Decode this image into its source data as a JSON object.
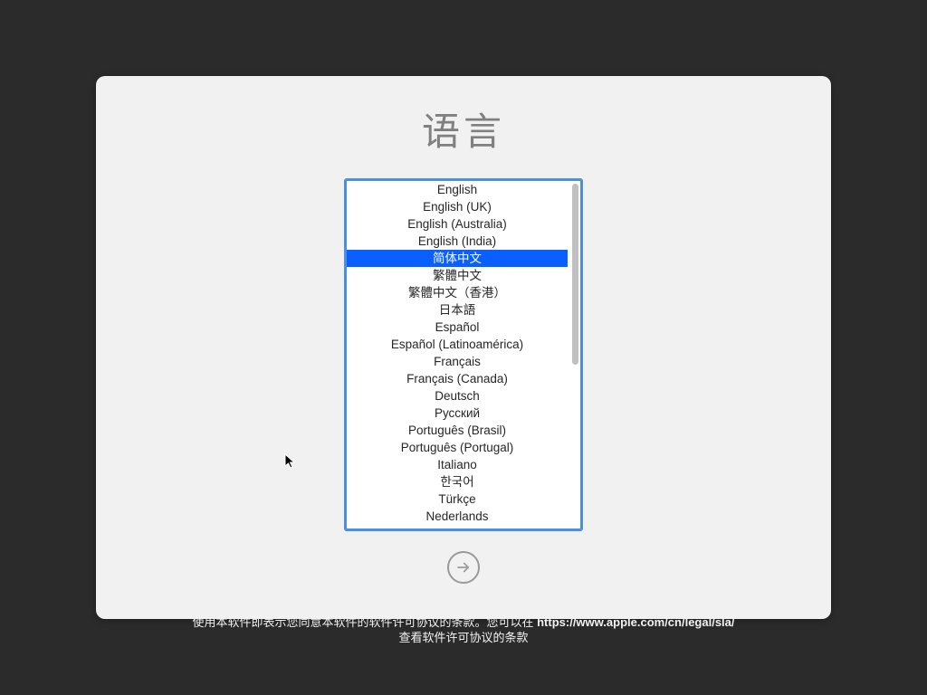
{
  "title": "语言",
  "languages": [
    {
      "label": "English",
      "selected": false
    },
    {
      "label": "English (UK)",
      "selected": false
    },
    {
      "label": "English (Australia)",
      "selected": false
    },
    {
      "label": "English (India)",
      "selected": false
    },
    {
      "label": "简体中文",
      "selected": true
    },
    {
      "label": "繁體中文",
      "selected": false
    },
    {
      "label": "繁體中文（香港）",
      "selected": false
    },
    {
      "label": "日本語",
      "selected": false
    },
    {
      "label": "Español",
      "selected": false
    },
    {
      "label": "Español (Latinoamérica)",
      "selected": false
    },
    {
      "label": "Français",
      "selected": false
    },
    {
      "label": "Français (Canada)",
      "selected": false
    },
    {
      "label": "Deutsch",
      "selected": false
    },
    {
      "label": "Русский",
      "selected": false
    },
    {
      "label": "Português (Brasil)",
      "selected": false
    },
    {
      "label": "Português (Portugal)",
      "selected": false
    },
    {
      "label": "Italiano",
      "selected": false
    },
    {
      "label": "한국어",
      "selected": false
    },
    {
      "label": "Türkçe",
      "selected": false
    },
    {
      "label": "Nederlands",
      "selected": false
    }
  ],
  "footer": {
    "line1_prefix": "使用本软件即表示您同意本软件的软件许可协议的条款。您可以在 ",
    "line1_url": "https://www.apple.com/cn/legal/sla/",
    "line2": "查看软件许可协议的条款"
  }
}
